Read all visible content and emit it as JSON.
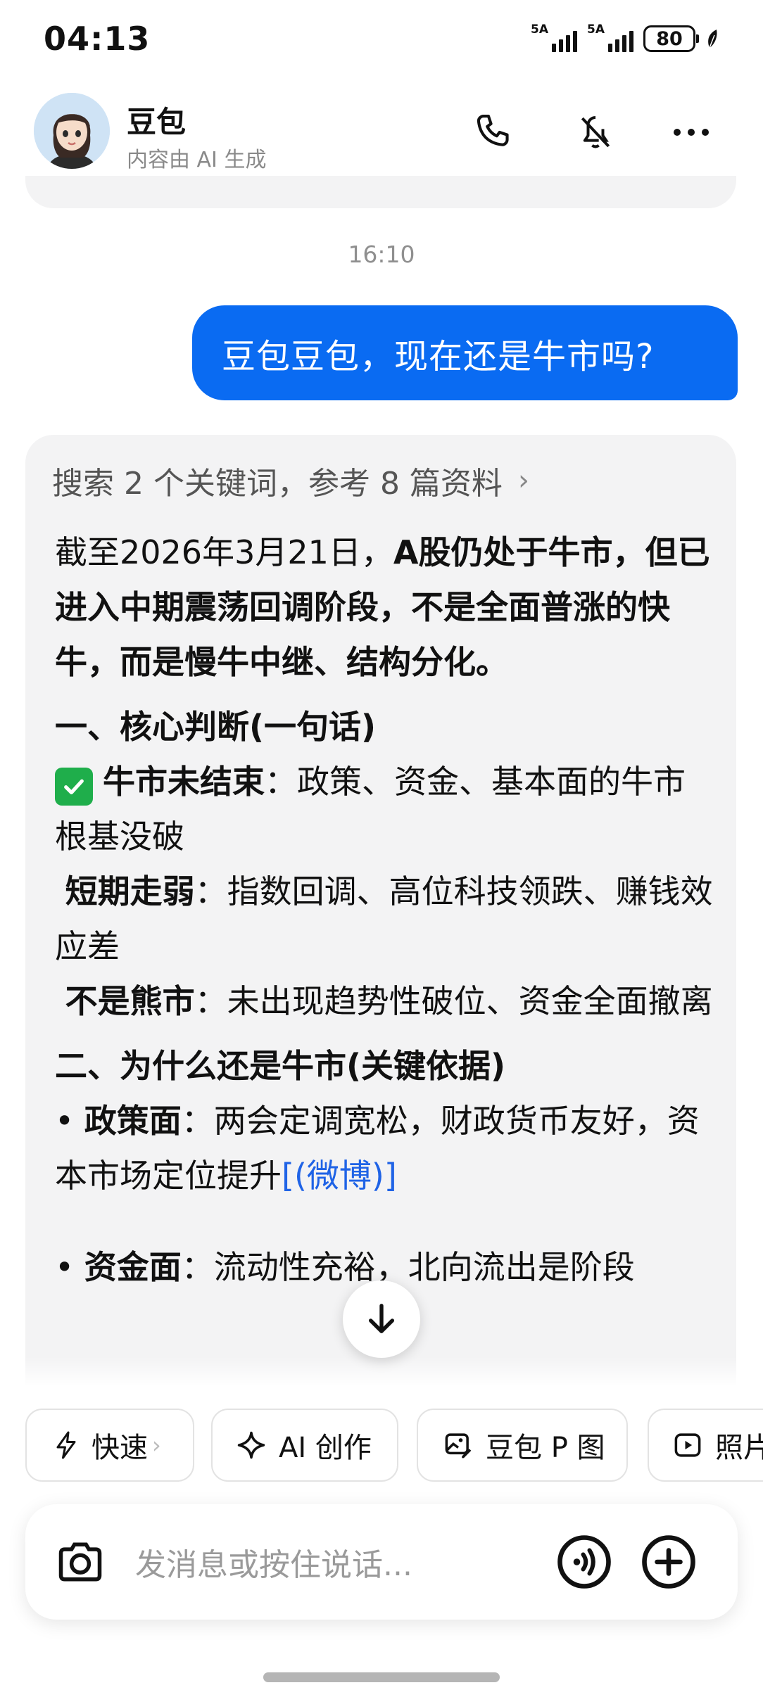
{
  "status_bar": {
    "time": "04:13",
    "sim1_label": "5A",
    "sim2_label": "5A",
    "battery": "80"
  },
  "header": {
    "name": "豆包",
    "subtitle": "内容由 AI 生成",
    "icons": [
      "phone-icon",
      "mute-icon",
      "more-icon"
    ]
  },
  "chat": {
    "timestamp": "16:10",
    "user_message": "豆包豆包，现在还是牛市吗?",
    "search_ref": "搜索 2 个关键词，参考 8 篇资料",
    "answer": {
      "intro_plain": "截至2026年3月21日，",
      "intro_bold": "A股仍处于牛市，但已进入中期震荡回调阶段，不是全面普涨的快牛，而是慢牛中继、结构分化。",
      "h1": "一、核心判断(一句话)",
      "p1_bold": "牛市未结束",
      "p1_text": "：政策、资金、基本面的牛市根基没破",
      "p2_bold": "短期走弱",
      "p2_text": "：指数回调、高位科技领跌、赚钱效应差",
      "p3_bold": "不是熊市",
      "p3_text": "：未出现趋势性破位、资金全面撤离",
      "h2": "二、为什么还是牛市(关键依据)",
      "b1_bold": "政策面",
      "b1_text": "：两会定调宽松，财政货币友好，资本市场定位提升",
      "b1_link": "[(微博)]",
      "b2_bold": "资金面",
      "b2_text": "：流动性充裕，北向流出是阶段"
    }
  },
  "toolbar": {
    "chips": [
      "快速",
      "AI 创作",
      "豆包 P 图",
      "照片"
    ],
    "input_placeholder": "发消息或按住说话..."
  },
  "colors": {
    "accent": "#0a6bf2",
    "link": "#1f63e6",
    "check": "#1fae4b",
    "card_bg": "#f3f3f4"
  }
}
